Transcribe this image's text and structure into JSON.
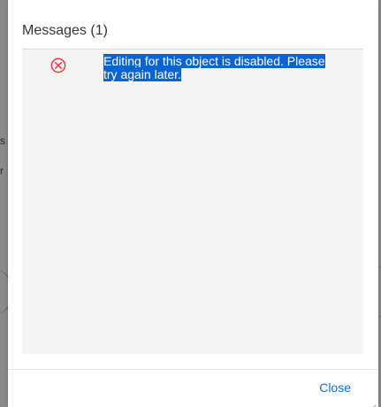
{
  "background": {
    "fragment_a": "s",
    "fragment_b": "r"
  },
  "dialog": {
    "title": "Messages (1)",
    "messages": [
      {
        "type": "error",
        "text": "Editing for this object is disabled. Please try again later."
      }
    ],
    "footer": {
      "close_label": "Close"
    }
  },
  "colors": {
    "error": "#e9383f",
    "link": "#0a6ed1",
    "selection": "#0a64d0",
    "panel": "#f4f4f4"
  },
  "icons": {
    "message_type": "error-circle-x-icon",
    "resize": "resize-grip-icon"
  }
}
